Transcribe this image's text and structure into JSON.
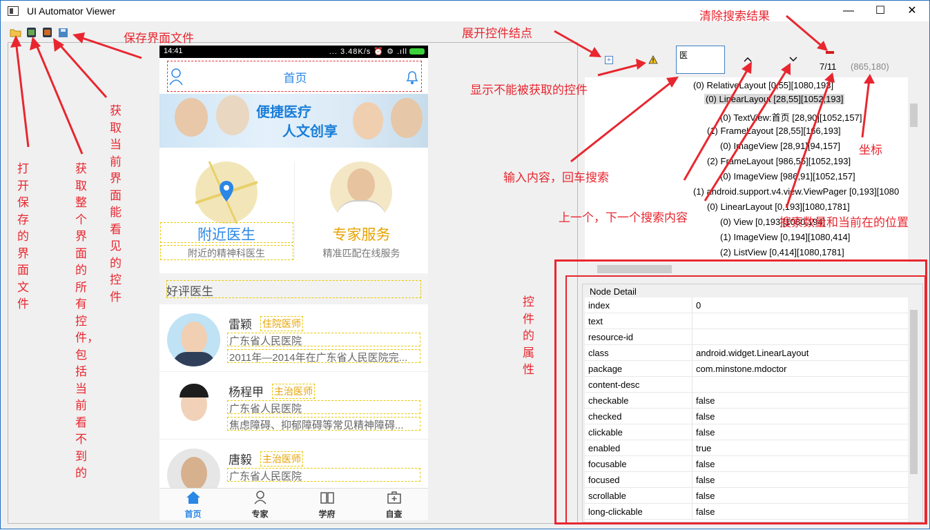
{
  "window": {
    "title": "UI Automator Viewer",
    "min": "—",
    "max": "☐",
    "close": "✕"
  },
  "toolbar": {
    "open": "folder-open-icon",
    "dump_all": "device-screenshot-icon",
    "dump_visible": "device-screenshot-compressed-icon",
    "save": "save-icon"
  },
  "phone": {
    "status_time": "14:41",
    "status_right": "... 3.48K/s ⏰ ⚙ .ıll",
    "header_title": "首页",
    "banner_line1": "便捷医疗",
    "banner_line2": "人文创享",
    "service1_title": "附近医生",
    "service1_sub": "附近的精神科医生",
    "service2_title": "专家服务",
    "service2_sub": "精准匹配在线服务",
    "section_title": "好评医生",
    "doctors": [
      {
        "name": "雷颖",
        "rank": "住院医师",
        "hospital": "广东省人民医院",
        "desc": "2011年—2014年在广东省人民医院完..."
      },
      {
        "name": "杨程甲",
        "rank": "主治医师",
        "hospital": "广东省人民医院",
        "desc": "焦虑障碍、抑郁障碍等常见精神障碍..."
      },
      {
        "name": "唐毅",
        "rank": "主治医师",
        "hospital": "广东省人民医院",
        "desc": ""
      }
    ],
    "tabs": [
      {
        "label": "首页"
      },
      {
        "label": "专家"
      },
      {
        "label": "学府"
      },
      {
        "label": "自查"
      }
    ]
  },
  "search": {
    "value": "医",
    "count": "7/11",
    "coords": "(865,180)"
  },
  "tree": [
    "(0) RelativeLayout [0,55][1080,193]",
    "(0) LinearLayout [28,55][1052,193]",
    "(0) TextView:首页 [28,90][1052,157]",
    "(1) FrameLayout [28,55][166,193]",
    "(0) ImageView [28,91][94,157]",
    "(2) FrameLayout [986,55][1052,193]",
    "(0) ImageView [986,91][1052,157]",
    "(1) android.support.v4.view.ViewPager [0,193][1080",
    "(0) LinearLayout [0,193][1080,1781]",
    "(0) View [0,193][1080,194]",
    "(1) ImageView [0,194][1080,414]",
    "(2) ListView [0,414][1080,1781]"
  ],
  "detail": {
    "legend": "Node Detail",
    "rows": [
      {
        "k": "index",
        "v": "0"
      },
      {
        "k": "text",
        "v": ""
      },
      {
        "k": "resource-id",
        "v": ""
      },
      {
        "k": "class",
        "v": "android.widget.LinearLayout"
      },
      {
        "k": "package",
        "v": "com.minstone.mdoctor"
      },
      {
        "k": "content-desc",
        "v": ""
      },
      {
        "k": "checkable",
        "v": "false"
      },
      {
        "k": "checked",
        "v": "false"
      },
      {
        "k": "clickable",
        "v": "false"
      },
      {
        "k": "enabled",
        "v": "true"
      },
      {
        "k": "focusable",
        "v": "false"
      },
      {
        "k": "focused",
        "v": "false"
      },
      {
        "k": "scrollable",
        "v": "false"
      },
      {
        "k": "long-clickable",
        "v": "false"
      }
    ]
  },
  "annotations": {
    "save": "保存界面文件",
    "expand": "展开控件结点",
    "clear": "清除搜索结果",
    "hidden": "显示不能被获取的控件",
    "open": "打开保存的界面文件",
    "dump_all": "获取整个界面的所有控件，包括当前看不到的",
    "dump_visible": "获取当前界面能看见的控件",
    "input": "输入内容，回车搜索",
    "prevnext": "上一个，下一个搜索内容",
    "countpos": "搜索数量和当前在的位置",
    "coord": "坐标",
    "props": "控件的属性"
  },
  "colors": {
    "annotation": "#e8262f",
    "accent": "#2a87e6",
    "gold": "#e6a300"
  }
}
